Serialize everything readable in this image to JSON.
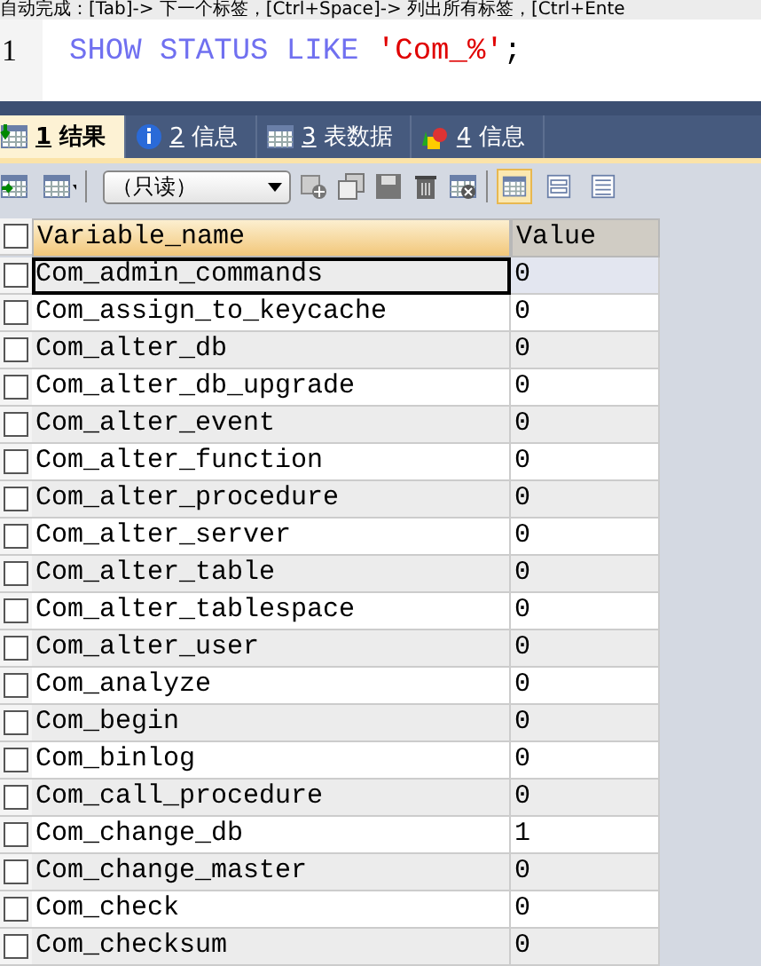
{
  "hint_bar": {
    "text": "自动完成：[Tab]-> 下一个标签，[Ctrl+Space]-> 列出所有标签，[Ctrl+Ente"
  },
  "editor": {
    "lines": [
      {
        "number": "1",
        "parts": [
          {
            "kind": "keyword",
            "text": "SHOW STATUS LIKE "
          },
          {
            "kind": "string",
            "text": "'Com_%'"
          },
          {
            "kind": "plain",
            "text": ";"
          }
        ]
      }
    ]
  },
  "tabs": [
    {
      "number": "1",
      "label": "结果",
      "selected": true
    },
    {
      "number": "2",
      "label": "信息",
      "selected": false
    },
    {
      "number": "3",
      "label": "表数据",
      "selected": false
    },
    {
      "number": "4",
      "label": "信息",
      "selected": false
    }
  ],
  "toolbar": {
    "mode_dropdown": {
      "value": "（只读）"
    },
    "views": [
      {
        "selected": true
      },
      {
        "selected": false
      },
      {
        "selected": false
      }
    ]
  },
  "table": {
    "columns": [
      "Variable_name",
      "Value"
    ],
    "select_all_checked": false,
    "rows": [
      {
        "cells": [
          "Com_admin_commands",
          "0"
        ],
        "selected": true,
        "checked": false
      },
      {
        "cells": [
          "Com_assign_to_keycache",
          "0"
        ],
        "selected": false,
        "checked": false
      },
      {
        "cells": [
          "Com_alter_db",
          "0"
        ],
        "selected": false,
        "checked": false
      },
      {
        "cells": [
          "Com_alter_db_upgrade",
          "0"
        ],
        "selected": false,
        "checked": false
      },
      {
        "cells": [
          "Com_alter_event",
          "0"
        ],
        "selected": false,
        "checked": false
      },
      {
        "cells": [
          "Com_alter_function",
          "0"
        ],
        "selected": false,
        "checked": false
      },
      {
        "cells": [
          "Com_alter_procedure",
          "0"
        ],
        "selected": false,
        "checked": false
      },
      {
        "cells": [
          "Com_alter_server",
          "0"
        ],
        "selected": false,
        "checked": false
      },
      {
        "cells": [
          "Com_alter_table",
          "0"
        ],
        "selected": false,
        "checked": false
      },
      {
        "cells": [
          "Com_alter_tablespace",
          "0"
        ],
        "selected": false,
        "checked": false
      },
      {
        "cells": [
          "Com_alter_user",
          "0"
        ],
        "selected": false,
        "checked": false
      },
      {
        "cells": [
          "Com_analyze",
          "0"
        ],
        "selected": false,
        "checked": false
      },
      {
        "cells": [
          "Com_begin",
          "0"
        ],
        "selected": false,
        "checked": false
      },
      {
        "cells": [
          "Com_binlog",
          "0"
        ],
        "selected": false,
        "checked": false
      },
      {
        "cells": [
          "Com_call_procedure",
          "0"
        ],
        "selected": false,
        "checked": false
      },
      {
        "cells": [
          "Com_change_db",
          "1"
        ],
        "selected": false,
        "checked": false
      },
      {
        "cells": [
          "Com_change_master",
          "0"
        ],
        "selected": false,
        "checked": false
      },
      {
        "cells": [
          "Com_check",
          "0"
        ],
        "selected": false,
        "checked": false
      },
      {
        "cells": [
          "Com_checksum",
          "0"
        ],
        "selected": false,
        "checked": false
      }
    ]
  }
}
